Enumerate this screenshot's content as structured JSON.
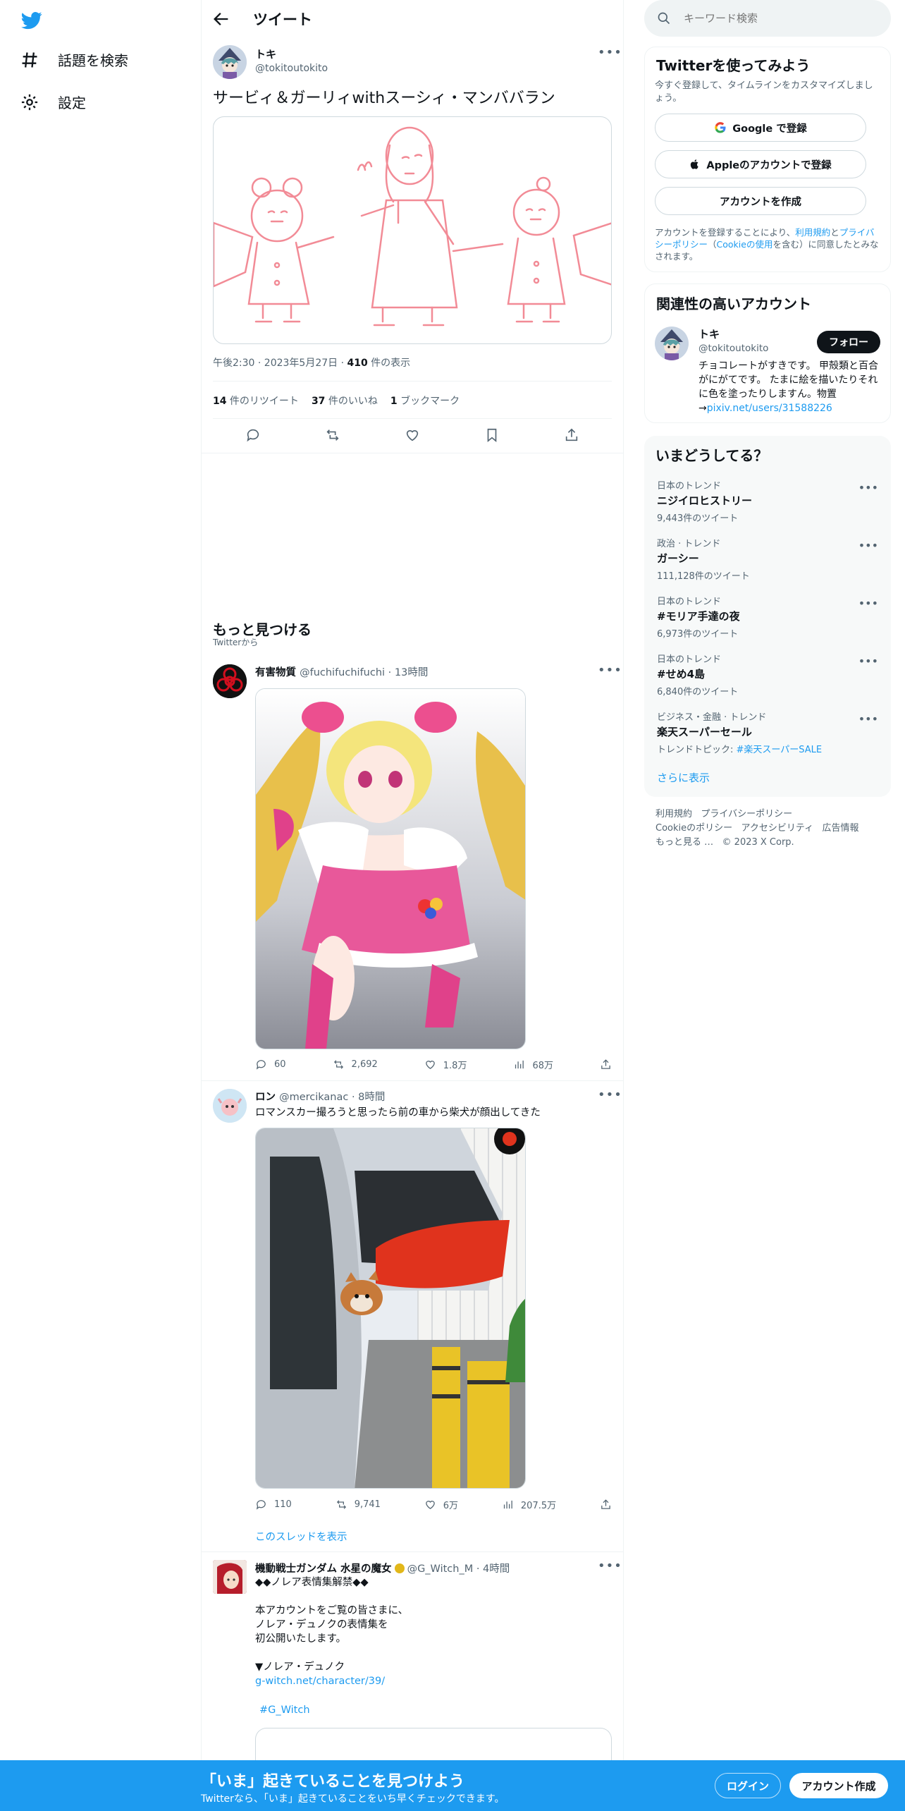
{
  "nav": {
    "explore_label": "話題を検索",
    "settings_label": "設定"
  },
  "header": {
    "title": "ツイート"
  },
  "tweet": {
    "author_name": "トキ",
    "author_handle": "@tokitoutokito",
    "text": "サービィ＆ガーリィwithスーシィ・マンババラン",
    "time": "午後2:30 · 2023年5月27日 · ",
    "views_count": "410",
    "views_label": " 件の表示",
    "retweets_count": "14",
    "retweets_label": " 件のリツイート",
    "likes_count": "37",
    "likes_label": " 件のいいね",
    "bookmarks_count": "1",
    "bookmarks_label": " ブックマーク"
  },
  "discover": {
    "title": "もっと見つける",
    "subtitle": "Twitterから"
  },
  "feed": [
    {
      "name": "有害物質",
      "handle": "@fuchifuchifuchi · 13時間",
      "replies": "60",
      "retweets": "2,692",
      "likes": "1.8万",
      "views": "68万"
    },
    {
      "name": "ロン",
      "handle": "@mercikanac · 8時間",
      "text": "ロマンスカー撮ろうと思ったら前の車から柴犬が顔出してきた",
      "replies": "110",
      "retweets": "9,741",
      "likes": "6万",
      "views": "207.5万",
      "thread_link": "このスレッドを表示"
    },
    {
      "name": "機動戦士ガンダム 水星の魔女",
      "handle": "@G_Witch_M · 4時間",
      "line1": "◆◆ノレア表情集解禁◆◆",
      "line2": "本アカウントをご覧の皆さまに、",
      "line3": "ノレア・デュノクの表情集を",
      "line4": "初公開いたします。",
      "line5": "▼ノレア・デュノク",
      "link": "g-witch.net/character/39/",
      "hashtag": "#G_Witch"
    }
  ],
  "search": {
    "placeholder": "キーワード検索"
  },
  "signup": {
    "title": "Twitterを使ってみよう",
    "desc": "今すぐ登録して、タイムラインをカスタマイズしましょう。",
    "google_label": "Google で登録",
    "apple_label": "Appleのアカウントで登録",
    "create_label": "アカウントを作成",
    "terms_prefix": "アカウントを登録することにより、",
    "terms_link": "利用規約",
    "and": "と",
    "privacy_link": "プライバシーポリシー",
    "cookie_open": "（",
    "cookie_link": "Cookieの使用",
    "terms_suffix": "を含む）に同意したとみなされます。"
  },
  "related": {
    "title": "関連性の高いアカウント",
    "name": "トキ",
    "handle": "@tokitoutokito",
    "follow_label": "フォロー",
    "bio": "チョコレートがすきです。 甲殻類と百合がにがてです。 たまに絵を描いたりそれに色を塗ったりしますん。物置→",
    "bio_link": "pixiv.net/users/31588226"
  },
  "trends": {
    "title": "いまどうしてる？",
    "items": [
      {
        "category": "日本のトレンド",
        "name": "ニジイロヒストリー",
        "count": "9,443件のツイート"
      },
      {
        "category": "政治 · トレンド",
        "name": "ガーシー",
        "count": "111,128件のツイート"
      },
      {
        "category": "日本のトレンド",
        "name": "#モリア手達の夜",
        "count": "6,973件のツイート"
      },
      {
        "category": "日本のトレンド",
        "name": "#せめ4島",
        "count": "6,840件のツイート"
      },
      {
        "category": "ビジネス・金融 · トレンド",
        "name": "楽天スーパーセール",
        "count_prefix": "トレンドトピック: ",
        "count_link": "#楽天スーパーSALE"
      }
    ],
    "show_more": "さらに表示"
  },
  "footer": {
    "terms": "利用規約",
    "privacy": "プライバシーポリシー",
    "cookie": "Cookieのポリシー",
    "accessibility": "アクセシビリティ",
    "ads": "広告情報",
    "more": "もっと見る …",
    "copyright": "© 2023 X Corp."
  },
  "bottom": {
    "title": "「いま」起きていることを見つけよう",
    "subtitle": "Twitterなら、「いま」起きていることをいち早くチェックできます。",
    "login_label": "ログイン",
    "signup_label": "アカウント作成"
  },
  "colors": {
    "accent": "#1d9bf0",
    "text": "#0f1419",
    "muted": "#536471",
    "sketch": "#f28b96"
  }
}
